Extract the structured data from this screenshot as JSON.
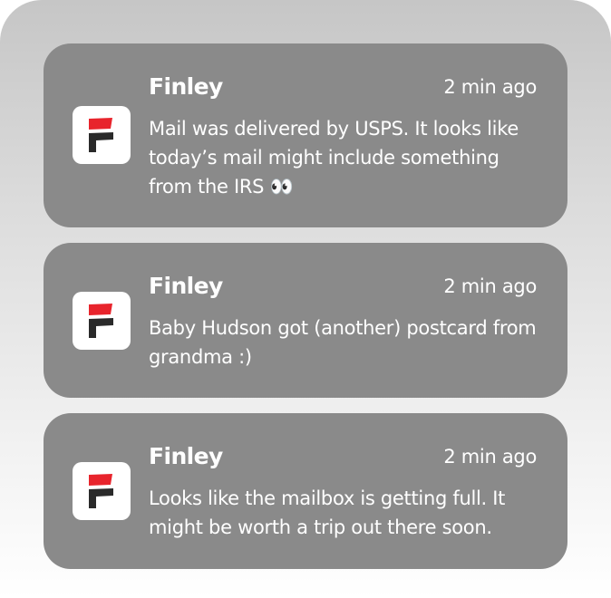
{
  "notifications": [
    {
      "app_name": "Finley",
      "time": "2 min ago",
      "message": "Mail was delivered by USPS. It looks like today’s mail might include something from the IRS 👀",
      "icon": "finley-logo-icon"
    },
    {
      "app_name": "Finley",
      "time": "2 min ago",
      "message": "Baby Hudson got (another) postcard from grandma :)",
      "icon": "finley-logo-icon"
    },
    {
      "app_name": "Finley",
      "time": "2 min ago",
      "message": "Looks like the mailbox is getting full. It might be worth a trip out there soon.",
      "icon": "finley-logo-icon"
    }
  ],
  "colors": {
    "card_background": "#8a8a8a",
    "logo_red": "#e8242c",
    "logo_dark": "#2a2a2a",
    "text": "#ffffff"
  }
}
